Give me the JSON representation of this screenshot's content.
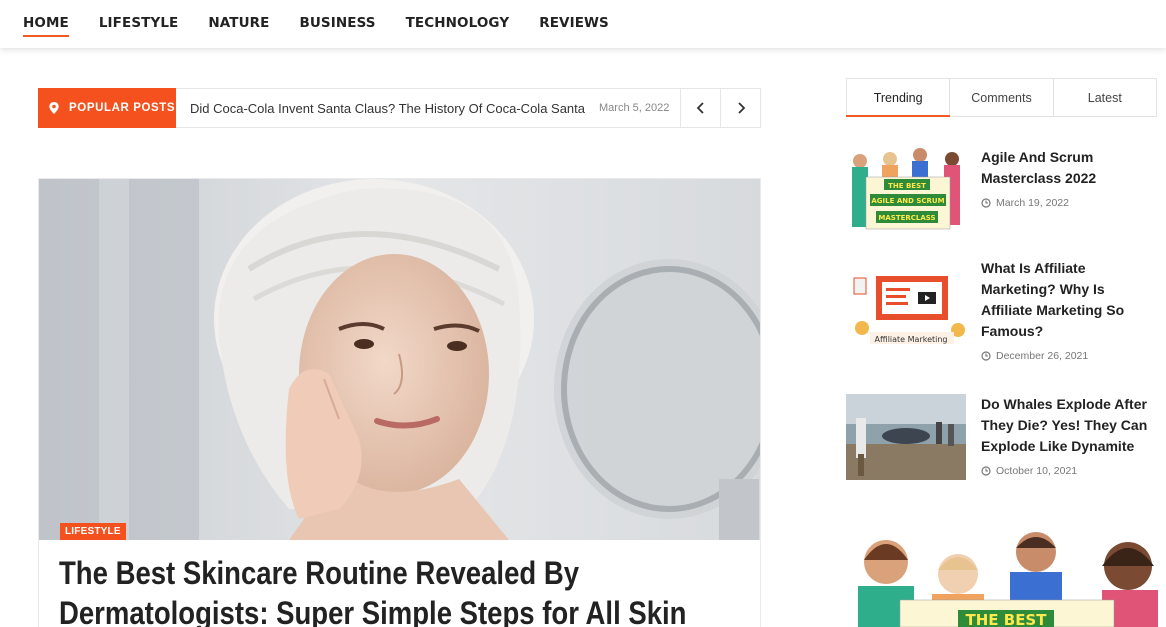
{
  "nav": {
    "items": [
      {
        "label": "HOME",
        "active": true
      },
      {
        "label": "LIFESTYLE",
        "active": false
      },
      {
        "label": "NATURE",
        "active": false
      },
      {
        "label": "BUSINESS",
        "active": false
      },
      {
        "label": "TECHNOLOGY",
        "active": false
      },
      {
        "label": "REVIEWS",
        "active": false
      }
    ]
  },
  "ticker": {
    "label": "POPULAR POSTS",
    "icon": "map-pin-icon",
    "title": "Did Coca-Cola Invent Santa Claus? The History Of Coca-Cola Santa",
    "date": "March 5, 2022",
    "prev_icon": "chevron-left-icon",
    "next_icon": "chevron-right-icon"
  },
  "hero": {
    "category": "LIFESTYLE",
    "title_line1": "The Best Skincare Routine Revealed By",
    "title_line2": "Dermatologists: Super Simple Steps for All Skin"
  },
  "sidebar": {
    "tabs": [
      {
        "label": "Trending",
        "active": true
      },
      {
        "label": "Comments",
        "active": false
      },
      {
        "label": "Latest",
        "active": false
      }
    ],
    "posts": [
      {
        "title": "Agile And Scrum Masterclass 2022",
        "date": "March 19, 2022",
        "thumb_text": [
          "THE BEST",
          "AGILE AND SCRUM",
          "MASTERCLASS"
        ]
      },
      {
        "title": "What Is Affiliate Marketing? Why Is Affiliate Marketing So Famous?",
        "date": "December 26, 2021",
        "thumb_text": [
          "Affiliate Marketing"
        ]
      },
      {
        "title": "Do Whales Explode After They Die? Yes! They Can Explode Like Dynamite",
        "date": "October 10, 2021"
      }
    ],
    "ad_text": "THE BEST"
  },
  "colors": {
    "accent": "#f4511e",
    "text": "#222222",
    "muted": "#888888"
  }
}
